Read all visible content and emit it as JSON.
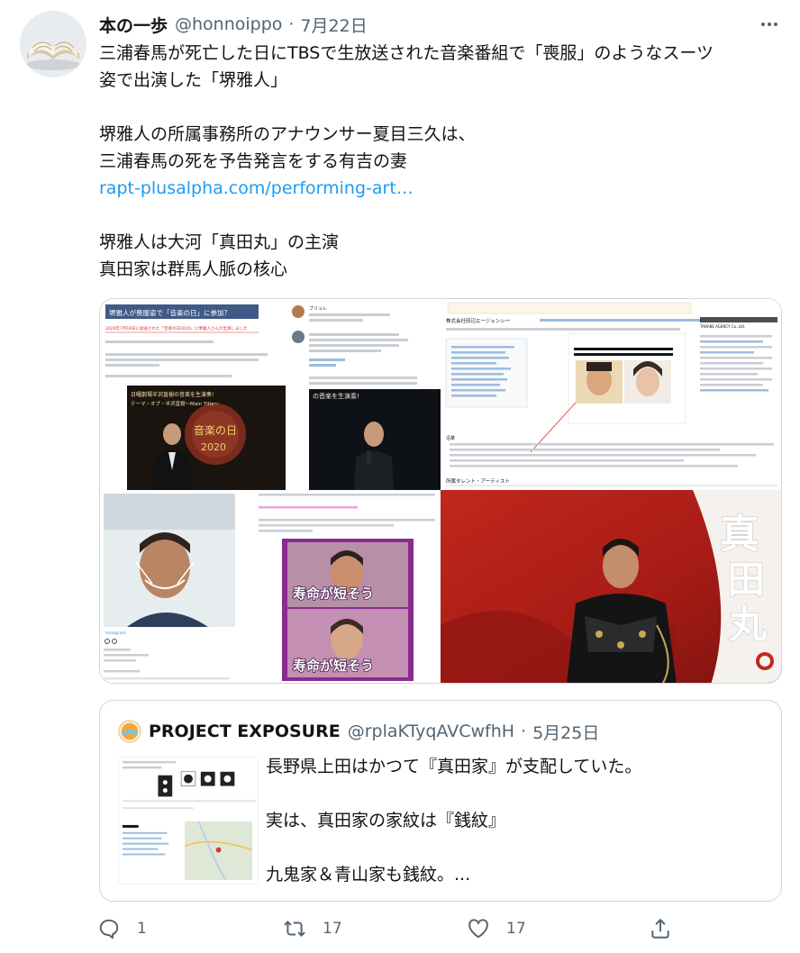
{
  "tweet": {
    "display_name": "本の一歩",
    "handle": "@honnoippo",
    "separator": "·",
    "date": "7月22日",
    "lines": [
      "三浦春馬が死亡した日にTBSで生放送された音楽番組で「喪服」のようなスーツ",
      "姿で出演した「堺雅人」",
      "堺雅人の所属事務所のアナウンサー夏目三久は、",
      "三浦春馬の死を予告発言をする有吉の妻",
      "rapt-plusalpha.com/performing-art…",
      "堺雅人は大河「真田丸」の主演",
      "真田家は群馬人脈の核心"
    ],
    "link_color": "#1d9bf0"
  },
  "media": {
    "top_left": {
      "title": "堺雅人が喪服姿で「音楽の日」に参加？",
      "caption": "2020年7月18日に放送された「音楽の日2020」に堺雅人さんが出演しました",
      "banner_lines": [
        "日曜劇場半沢直樹の音楽を生演奏!",
        "テーマ・オブ・半沢直樹〜Main Title〜"
      ],
      "overlay_text": "音楽の日",
      "overlay_year": "2020"
    },
    "top_middle": {
      "account": "ブリュレ",
      "banner": "の音楽を生演奏!"
    },
    "top_right": {
      "company": "株式会社田辺エージェンシー",
      "company_en": "TANABE AGENCY Co.,Ltd.",
      "section_tenants": "所属タレント・アーティスト",
      "section_history": "沿革"
    },
    "bottom_left": {
      "label": "Instagram"
    },
    "bottom_middle": {
      "caption1": "寿命が短そう",
      "caption2": "寿命が短そう"
    },
    "bottom_right": {
      "title_chars": [
        "真",
        "田",
        "丸"
      ]
    }
  },
  "quote": {
    "display_name": "PROJECT EXPOSURE",
    "handle": "@rplaKTyqAVCwfhH",
    "separator": "·",
    "date": "5月25日",
    "lines": [
      "長野県上田はかつて『真田家』が支配していた。",
      "実は、真田家の家紋は『銭紋』",
      "九鬼家＆青山家も銭紋。..."
    ]
  },
  "actions": {
    "reply_count": "1",
    "retweet_count": "17",
    "like_count": "17",
    "icons": [
      "reply-icon",
      "retweet-icon",
      "like-icon",
      "share-icon"
    ]
  },
  "colors": {
    "text": "#0f1419",
    "secondary": "#536471",
    "border": "#cfd9de",
    "link": "#1d9bf0"
  }
}
